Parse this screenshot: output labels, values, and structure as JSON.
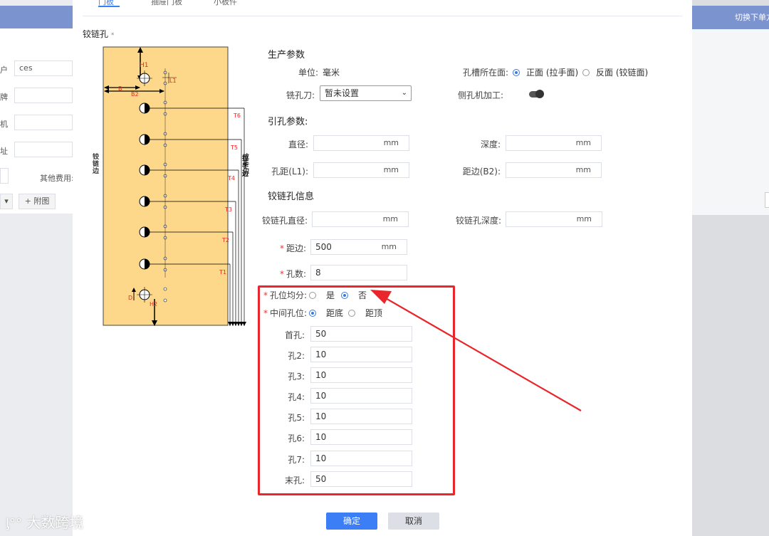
{
  "background": {
    "right_bar_text": "切换下单方",
    "left_labels": [
      "户",
      "牌",
      "机",
      "址"
    ],
    "left_customer_value": "ces",
    "other_fee_label": "其他费用:",
    "attach_button": "+ 附图",
    "small_dropdown": "▾"
  },
  "tabs": [
    "门板",
    "抽屉门板",
    "小板件"
  ],
  "hinge_title": "铰链孔",
  "hinge_title_star": "*",
  "diagram": {
    "h1": "H1",
    "l1": "L1",
    "b": "B",
    "b2": "B2",
    "h2": "H2",
    "d": "D",
    "t_labels": [
      "T6",
      "T5",
      "T4",
      "T3",
      "T2",
      "T1"
    ],
    "left_side_label": [
      "铰",
      "链",
      "边"
    ],
    "right_side_label": [
      "拉",
      "手",
      "边"
    ],
    "fill_color": "#fdd88a"
  },
  "production": {
    "title": "生产参数",
    "unit_label": "单位:",
    "unit_value": "毫米",
    "slot_face_label": "孔槽所在面:",
    "face_front": "正面 (拉手面)",
    "face_back": "反面 (铰链面)",
    "cutter_label": "铣孔刀:",
    "cutter_value": "暂未设置",
    "side_hole_label": "侧孔机加工:"
  },
  "pilot": {
    "title": "引孔参数:",
    "diameter_label": "直径:",
    "depth_label": "深度:",
    "distance_label": "孔距(L1):",
    "edge_label": "距边(B2):",
    "unit": "mm"
  },
  "hinge": {
    "title": "铰链孔信息",
    "diameter_label": "铰链孔直径:",
    "depth_label": "铰链孔深度:",
    "edge_label": "距边:",
    "edge_value": "500",
    "count_label": "孔数:",
    "count_value": "8",
    "even_label": "孔位均分:",
    "even_yes": "是",
    "even_no": "否",
    "middle_label": "中间孔位:",
    "middle_bottom": "距底",
    "middle_top": "距顶",
    "unit": "mm",
    "holes": [
      {
        "label": "首孔:",
        "value": "50"
      },
      {
        "label": "孔2:",
        "value": "10"
      },
      {
        "label": "孔3:",
        "value": "10"
      },
      {
        "label": "孔4:",
        "value": "10"
      },
      {
        "label": "孔5:",
        "value": "10"
      },
      {
        "label": "孔6:",
        "value": "10"
      },
      {
        "label": "孔7:",
        "value": "10"
      },
      {
        "label": "末孔:",
        "value": "50"
      }
    ]
  },
  "buttons": {
    "ok": "确定",
    "cancel": "取消"
  },
  "watermark": "大数跨境",
  "colors": {
    "accent": "#3b7ef5",
    "highlight": "#e8262b"
  }
}
